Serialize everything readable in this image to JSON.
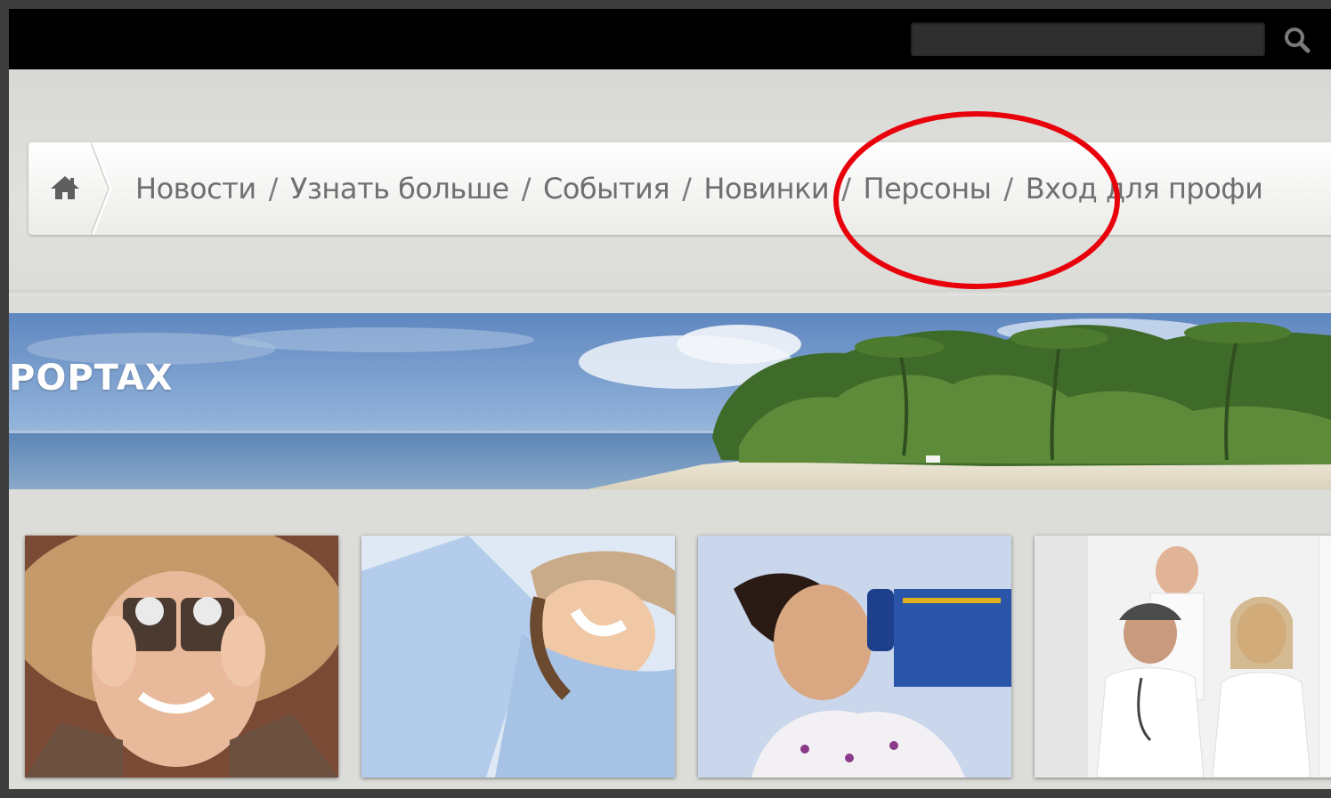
{
  "search": {
    "value": "",
    "placeholder": ""
  },
  "breadcrumb": {
    "home_icon": "home-icon",
    "items": [
      {
        "label": "Новости"
      },
      {
        "label": "Узнать больше"
      },
      {
        "label": "События"
      },
      {
        "label": "Новинки"
      },
      {
        "label": "Персоны"
      },
      {
        "label": "Вход для профи"
      }
    ],
    "separator": "/"
  },
  "banner": {
    "title": "POPTAX"
  },
  "tiles": [
    {
      "icon": "woman-binoculars-photo"
    },
    {
      "icon": "laughing-woman-hat-photo"
    },
    {
      "icon": "woman-phone-photo"
    },
    {
      "icon": "medical-staff-photo"
    }
  ],
  "annotation": {
    "color": "#e8000b"
  },
  "colors": {
    "topbar": "#000000",
    "breadcrumb_text": "#6f6f6f",
    "page_bg": "#dcdcd8"
  }
}
